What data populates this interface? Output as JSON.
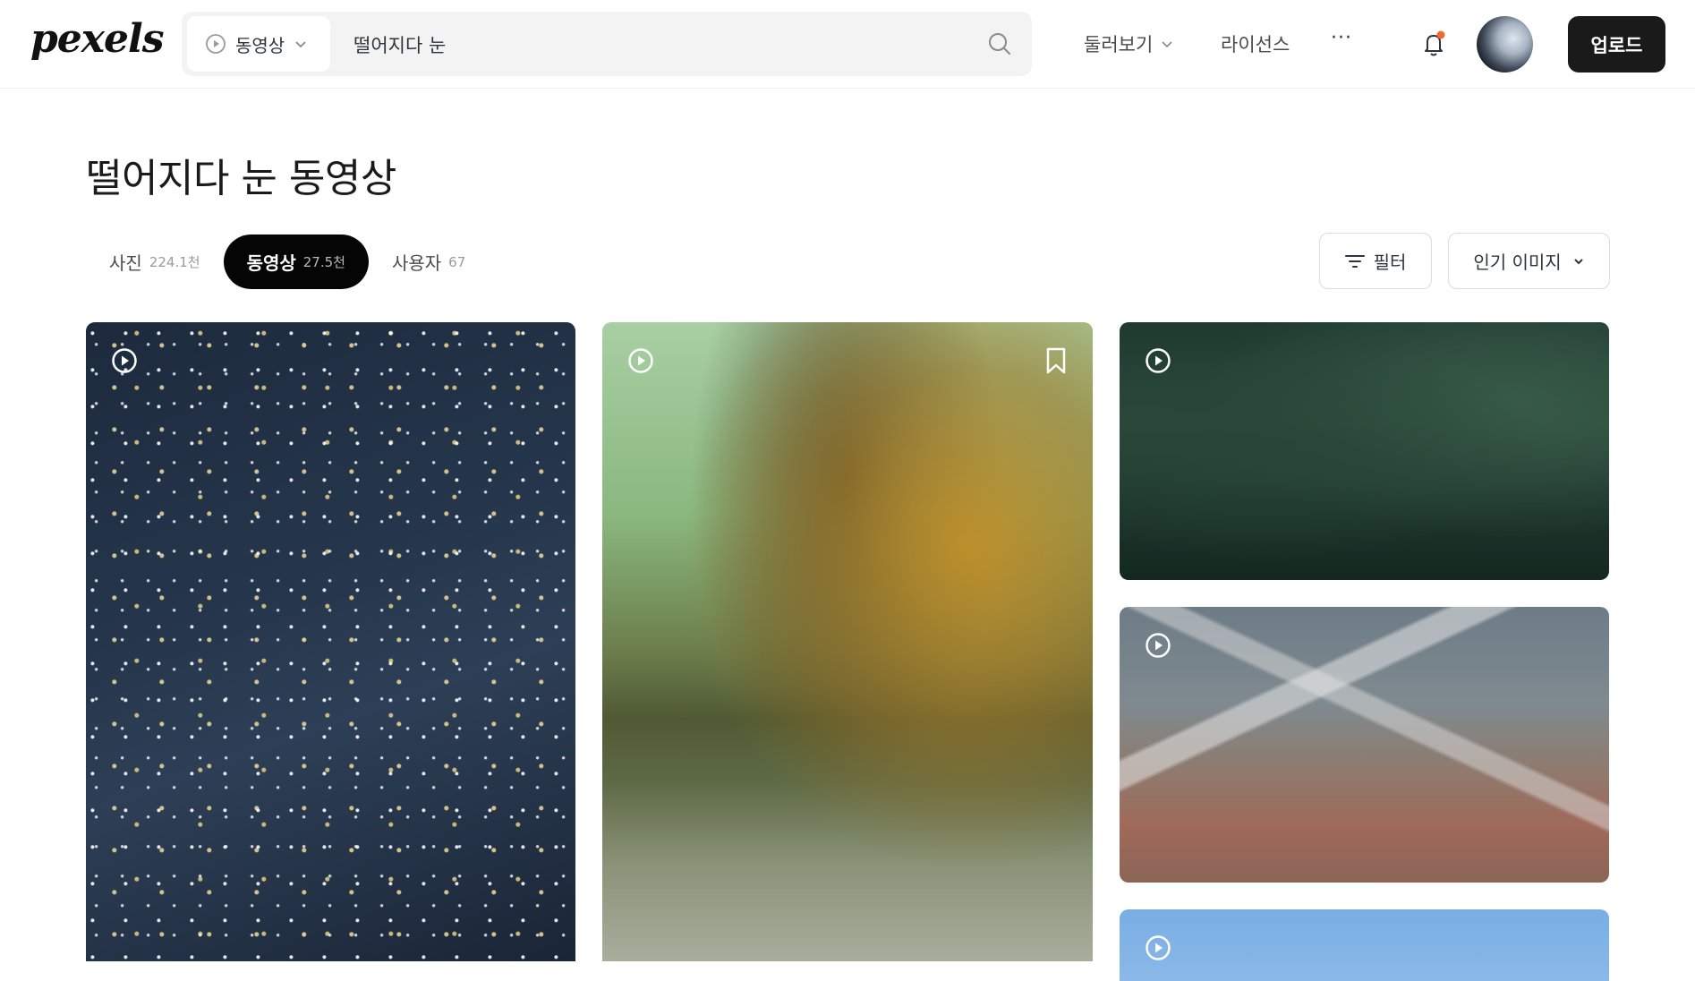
{
  "header": {
    "logo": "pexels",
    "search": {
      "type_label": "동영상",
      "query": "떨어지다 눈"
    },
    "nav": {
      "explore": "둘러보기",
      "license": "라이선스",
      "more": "···"
    },
    "upload_label": "업로드"
  },
  "page": {
    "title": "떨어지다 눈 동영상"
  },
  "tabs": [
    {
      "label": "사진",
      "count": "224.1천",
      "active": false
    },
    {
      "label": "동영상",
      "count": "27.5천",
      "active": true
    },
    {
      "label": "사용자",
      "count": "67",
      "active": false
    }
  ],
  "controls": {
    "filter_label": "필터",
    "sort_label": "인기 이미지"
  },
  "results": [
    {
      "kind": "video",
      "scene": "falling snow night",
      "bookmarked_visible": false
    },
    {
      "kind": "video",
      "scene": "autumn tree field",
      "bookmarked_visible": true
    },
    {
      "kind": "video",
      "scene": "evergreen branches snow",
      "bookmarked_visible": false
    },
    {
      "kind": "video",
      "scene": "snowy grass stalks",
      "bookmarked_visible": false
    },
    {
      "kind": "video",
      "scene": "blue sky",
      "bookmarked_visible": false
    }
  ],
  "colors": {
    "text": "#2c343e",
    "upload_bg": "#1a1a1a",
    "active_tab_bg": "#050505",
    "search_bg": "#f3f3f3",
    "notification_dot": "#f26b2e"
  }
}
